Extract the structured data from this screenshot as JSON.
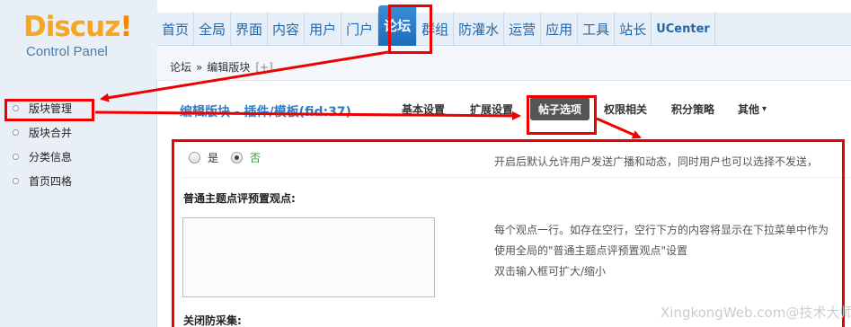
{
  "logo": {
    "title": "Discuz",
    "bang": "!",
    "subtitle": "Control Panel"
  },
  "topnav": [
    "首页",
    "全局",
    "界面",
    "内容",
    "用户",
    "门户",
    "论坛",
    "群组",
    "防灌水",
    "运营",
    "应用",
    "工具",
    "站长",
    "UCenter"
  ],
  "breadcrumb": {
    "root": "论坛",
    "sep": "»",
    "current": "编辑版块",
    "plus": "[+]"
  },
  "sidebar": [
    "版块管理",
    "版块合并",
    "分类信息",
    "首页四格"
  ],
  "page_title": "编辑版块 - 插件/模板(fid:37)",
  "tabs": [
    "基本设置",
    "扩展设置",
    "帖子选项",
    "权限相关",
    "积分策略",
    "其他"
  ],
  "tab_caret": "▾",
  "form": {
    "radio_yes": "是",
    "radio_no": "否",
    "tip1": "开启后默认允许用户发送广播和动态，同时用户也可以选择不发送，",
    "label_viewpoints": "普通主题点评预置观点:",
    "tip2_line1": "每个观点一行。如存在空行，空行下方的内容将显示在下拉菜单中作为",
    "tip2_line2": "使用全局的\"普通主题点评预置观点\"设置",
    "tip2_line3": "双击输入框可扩大/缩小",
    "label_anticollect": "关闭防采集:"
  },
  "watermark": "XingkongWeb.com@技术大师",
  "colors": {
    "annotation": "#ee0000",
    "link": "#2366a8",
    "active_tab": "#555555"
  }
}
